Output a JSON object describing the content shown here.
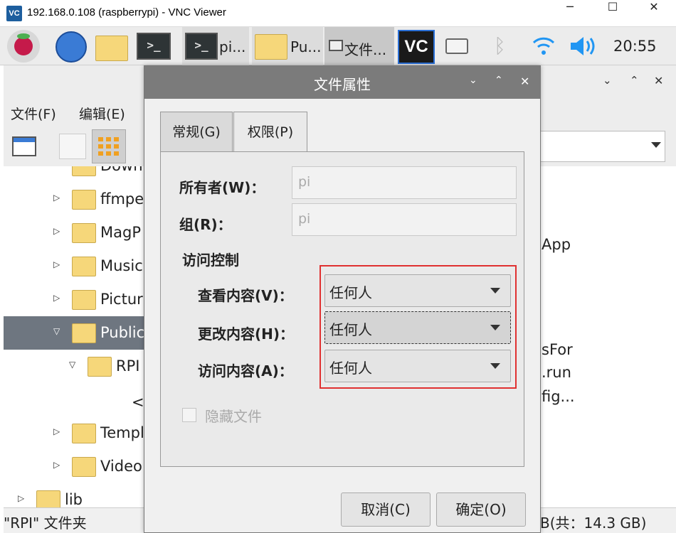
{
  "window": {
    "title": "192.168.0.108 (raspberrypi) - VNC Viewer",
    "app_icon": "VC",
    "minimize": "─",
    "maximize": "☐",
    "close": "✕"
  },
  "taskbar": {
    "items": [
      {
        "label": "pi..."
      },
      {
        "label": "Pu..."
      },
      {
        "label": "文件..."
      }
    ],
    "clock": "20:55"
  },
  "file_manager": {
    "menu": [
      "文件(F)",
      "编辑(E)"
    ],
    "tree": [
      {
        "label": "Down",
        "arrow": ""
      },
      {
        "label": "ffmpe",
        "arrow": "▷"
      },
      {
        "label": "MagP",
        "arrow": "▷"
      },
      {
        "label": "Music",
        "arrow": "▷"
      },
      {
        "label": "Pictur",
        "arrow": "▷"
      },
      {
        "label": "Public",
        "arrow": "▽",
        "selected": true
      },
      {
        "label": "RPI",
        "arrow": "▽"
      },
      {
        "label": "<文",
        "arrow": ""
      },
      {
        "label": "Templ",
        "arrow": "▷"
      },
      {
        "label": "Video",
        "arrow": "▷"
      },
      {
        "label": "lib",
        "arrow": "▷"
      }
    ],
    "right_items": [
      "App",
      "sFor",
      ".run",
      "fig..."
    ],
    "status_left": "\"RPI\" 文件夹",
    "status_right": "B(共：14.3 GB)"
  },
  "dialog": {
    "title": "文件属性",
    "tabs": [
      "常规(G)",
      "权限(P)"
    ],
    "owner_label": "所有者(W)：",
    "owner_value": "pi",
    "group_label": "组(R)：",
    "group_value": "pi",
    "access_heading": "访问控制",
    "view_label": "查看内容(V)：",
    "view_value": "任何人",
    "change_label": "更改内容(H)：",
    "change_value": "任何人",
    "access_label": "访问内容(A)：",
    "access_value": "任何人",
    "hidden_label": "隐藏文件",
    "cancel": "取消(C)",
    "ok": "确定(O)"
  },
  "colors": {
    "dialog_header": "#7b7b7b",
    "highlight": "#e03131",
    "selected_row": "#6e7680"
  }
}
